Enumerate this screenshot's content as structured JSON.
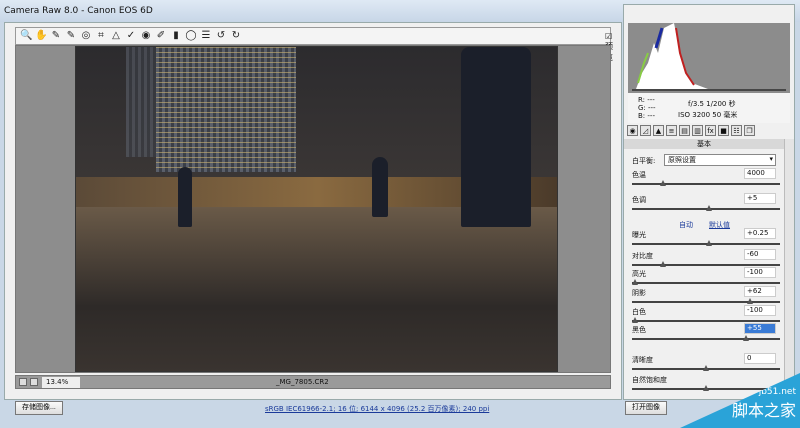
{
  "window": {
    "title": "Camera Raw 8.0 -  Canon EOS 6D"
  },
  "toolbar": {
    "tools": [
      "zoom-icon",
      "hand-icon",
      "white-balance-icon",
      "color-sampler-icon",
      "target-adjust-icon",
      "crop-icon",
      "straighten-icon",
      "spot-removal-icon",
      "red-eye-icon",
      "adjustment-brush-icon",
      "graduated-filter-icon",
      "radial-filter-icon",
      "preferences-icon",
      "rotate-ccw-icon",
      "rotate-cw-icon"
    ],
    "preview_label": "预览",
    "preview_checked": true
  },
  "status": {
    "zoom": "13.4%",
    "filename": "_MG_7805.CR2"
  },
  "footer": {
    "save_label": "存储图像...",
    "workflow_link": "sRGB IEC61966-2.1; 16 位; 6144 x 4096 (25.2 百万像素); 240 ppi",
    "open_label": "打开图像"
  },
  "info": {
    "r": "R:  ---",
    "g": "G:  ---",
    "b": "B:  ---",
    "exposure": "f/3.5   1/200 秒",
    "iso": "ISO 3200   50 毫米"
  },
  "panel": {
    "title": "基本",
    "wb_label": "白平衡:",
    "wb_value": "原照设置",
    "auto": "自动",
    "default": "默认值",
    "sliders": [
      {
        "label": "色温",
        "value": "4000",
        "pos": 0.2
      },
      {
        "label": "色调",
        "value": "+5",
        "pos": 0.52
      },
      {
        "label": "曝光",
        "value": "+0.25",
        "pos": 0.52
      },
      {
        "label": "对比度",
        "value": "-60",
        "pos": 0.2
      },
      {
        "label": "高光",
        "value": "-100",
        "pos": 0.0
      },
      {
        "label": "阴影",
        "value": "+62",
        "pos": 0.81
      },
      {
        "label": "白色",
        "value": "-100",
        "pos": 0.0
      },
      {
        "label": "黑色",
        "value": "+55",
        "pos": 0.78
      },
      {
        "label": "清晰度",
        "value": "0",
        "pos": 0.5
      },
      {
        "label": "自然饱和度",
        "value": "",
        "pos": 0.5
      }
    ]
  },
  "watermark": {
    "site": "jb51.net",
    "name": "脚本之家"
  }
}
